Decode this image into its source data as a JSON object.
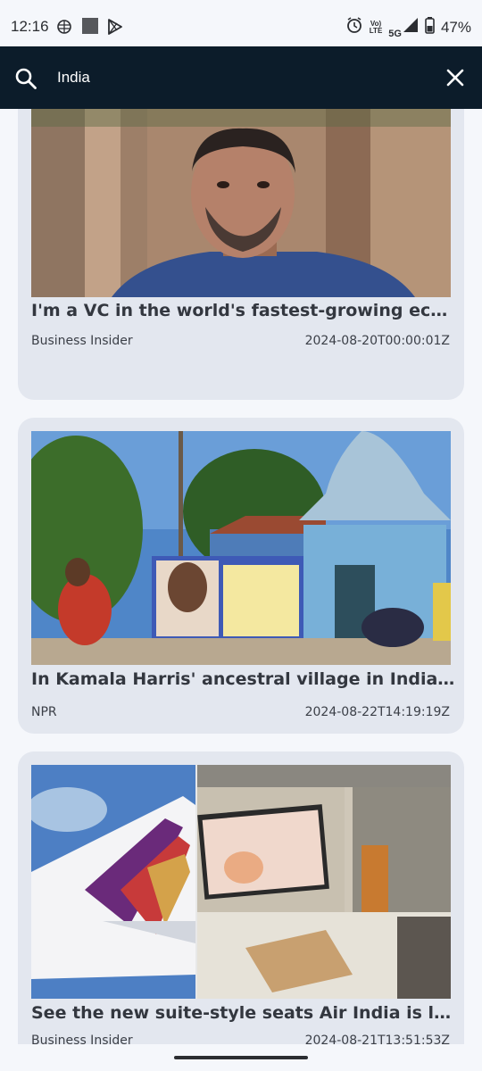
{
  "status_bar": {
    "time": "12:16",
    "network_top": "Vo)",
    "network_bottom": "LTE",
    "signal_label": "5G",
    "battery": "47%",
    "icons": [
      "brain-icon",
      "square-icon",
      "play-store-icon",
      "alarm-icon",
      "signal-icon",
      "battery-icon"
    ]
  },
  "search": {
    "query": "India",
    "icon": "search-icon",
    "close_icon": "close-icon"
  },
  "articles": [
    {
      "title": "I'm a VC in the world's fastest-growing economy...",
      "source": "Business Insider",
      "date": "2024-08-20T00:00:01Z"
    },
    {
      "title": "In Kamala Harris' ancestral village in India, people...",
      "source": "NPR",
      "date": "2024-08-22T14:19:19Z"
    },
    {
      "title": "See the new suite-style seats Air India is launching...",
      "source": "Business Insider",
      "date": "2024-08-21T13:51:53Z"
    }
  ],
  "colors": {
    "header_bg": "#0c1c2a",
    "card_bg": "#e3e7ef",
    "page_bg": "#f5f7fb",
    "title_text": "#33373f"
  }
}
